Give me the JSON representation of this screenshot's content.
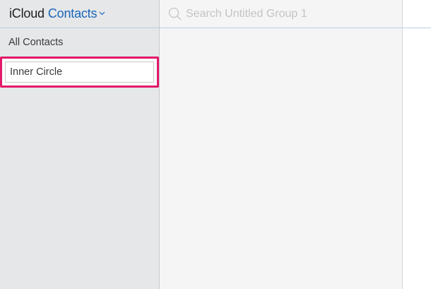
{
  "header": {
    "brand": "iCloud",
    "app_name": "Contacts"
  },
  "sidebar": {
    "all_contacts_label": "All Contacts",
    "groups": [
      {
        "label": "Inner Circle",
        "state": "editing"
      }
    ]
  },
  "search": {
    "placeholder": "Search Untitled Group 1",
    "value": ""
  },
  "icons": {
    "app_switch": "chevron-down-icon",
    "search": "search-icon"
  },
  "colors": {
    "accent": "#1a66b8",
    "highlight_border": "#e2186a",
    "sidebar_bg": "#e6e7e9",
    "list_bg": "#f5f5f6"
  }
}
